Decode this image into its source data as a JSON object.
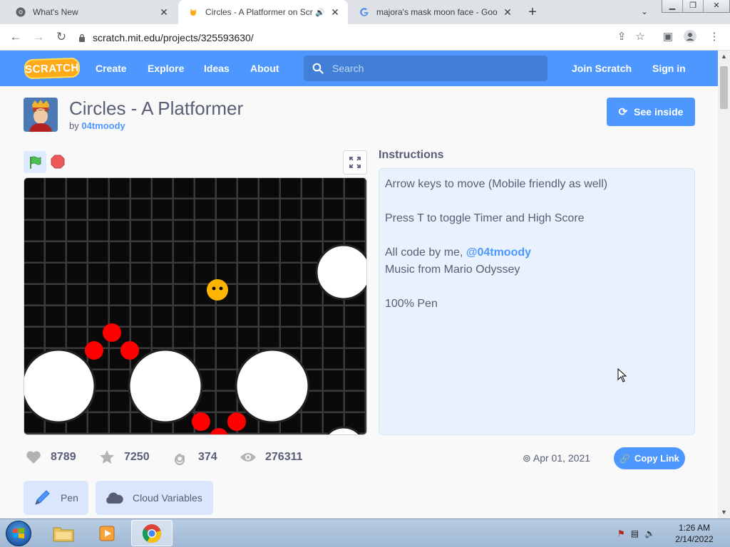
{
  "browser": {
    "tabs": [
      {
        "title": "What's New",
        "active": false
      },
      {
        "title": "Circles - A Platformer on Scr",
        "active": true,
        "audio": true
      },
      {
        "title": "majora's mask moon face - Goo",
        "active": false
      }
    ],
    "url": "scratch.mit.edu/projects/325593630/"
  },
  "scratch_header": {
    "logo": "SCRATCH",
    "nav": [
      "Create",
      "Explore",
      "Ideas",
      "About"
    ],
    "search_placeholder": "Search",
    "join": "Join Scratch",
    "signin": "Sign in"
  },
  "project": {
    "title": "Circles - A Platformer",
    "by_prefix": "by",
    "author": "04tmoody",
    "see_inside": "See inside",
    "instructions_heading": "Instructions",
    "instructions": {
      "line1": "Arrow keys to move (Mobile friendly as well)",
      "line2": "Press T to toggle Timer and High Score",
      "line3_prefix": "All code by me,",
      "line3_mention": "@04tmoody",
      "line4": "Music from Mario Odyssey",
      "line5": "100% Pen"
    },
    "stats": {
      "loves": "8789",
      "favorites": "7250",
      "remixes": "374",
      "views": "276311"
    },
    "shared": "Apr 01, 2021",
    "copy_link": "Copy Link",
    "extensions": [
      "Pen",
      "Cloud Variables"
    ]
  },
  "taskbar": {
    "time": "1:26 AM",
    "date": "2/14/2022"
  },
  "colors": {
    "scratch_blue": "#4d97ff",
    "scratch_text": "#575e75",
    "instructions_bg": "#e9f1fc"
  },
  "icons": [
    "chrome-icon",
    "scratch-cat-icon",
    "google-icon",
    "search-icon",
    "green-flag-icon",
    "stop-icon",
    "fullscreen-icon",
    "heart-icon",
    "star-icon",
    "remix-icon",
    "eye-icon",
    "pen-icon",
    "cloud-icon",
    "link-icon"
  ]
}
